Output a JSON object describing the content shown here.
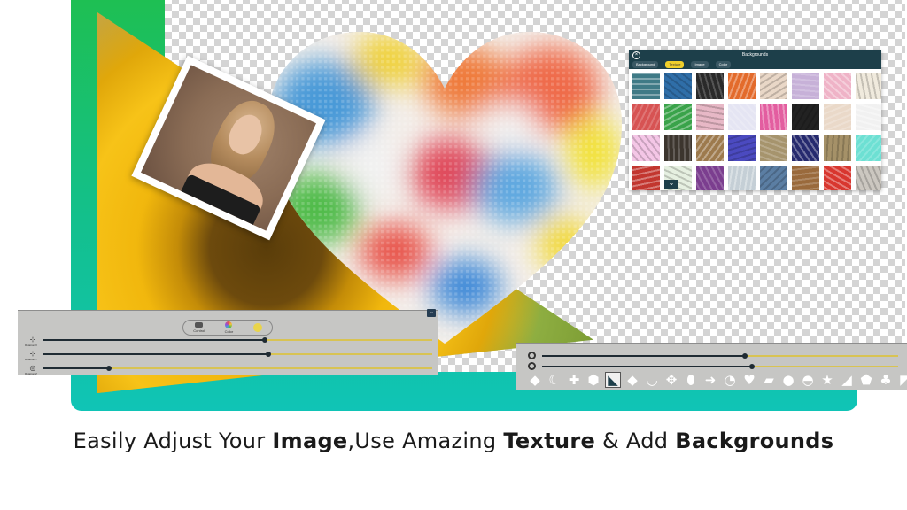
{
  "backgrounds_panel": {
    "title": "Backgrounds",
    "close_icon": "close-icon",
    "tabs": [
      {
        "label": "Background"
      },
      {
        "label": "Texture",
        "active": true
      },
      {
        "label": "Image"
      },
      {
        "label": "Color"
      }
    ],
    "expand_icon": "chevron-down-icon",
    "tile_colors": [
      "#3f7a86",
      "#2f6ea8",
      "#2a2a2a",
      "#e36b2c",
      "#e9d7c7",
      "#c7b1d8",
      "#efb3c7",
      "#f0eadd",
      "#d75353",
      "#3aa34a",
      "#e7b8c6",
      "#e5e5f3",
      "#e35ea0",
      "#222222",
      "#ead9c9",
      "#f1f1f1",
      "#f4c6e6",
      "#3c352e",
      "#9d7a4d",
      "#4b4ac0",
      "#a6946d",
      "#262a6e",
      "#a59168",
      "#6de0d3",
      "#c2362f",
      "#e6f0e1",
      "#7b3e8f",
      "#c5cfd6",
      "#5b7ea3",
      "#9a6a3c",
      "#d8372f",
      "#cbc7c0"
    ]
  },
  "adjust_panel": {
    "collapse_icon": "chevron-down-icon",
    "segments": [
      {
        "label": "Control",
        "icon": "sliders-icon",
        "color": "#555555"
      },
      {
        "label": "Color",
        "icon": "color-wheel-icon",
        "color": "#e8534a"
      },
      {
        "label": "",
        "icon": "sun-icon",
        "color": "#e9d44a"
      }
    ],
    "sliders": [
      {
        "icon": "rotate-x-icon",
        "glyph": "⊹",
        "label": "Rotation X",
        "value": 0.57
      },
      {
        "icon": "rotate-y-icon",
        "glyph": "⊹",
        "label": "Rotation Y",
        "value": 0.58
      },
      {
        "icon": "rotate-z-icon",
        "glyph": "◎",
        "label": "Rotation Z",
        "value": 0.17
      }
    ]
  },
  "shape_panel": {
    "sliders": [
      {
        "icon": "size-icon",
        "value": 0.57
      },
      {
        "icon": "opacity-icon",
        "value": 0.59
      }
    ],
    "shapes": [
      {
        "icon": "diamond-shape-icon",
        "glyph": "◆"
      },
      {
        "icon": "crescent-shape-icon",
        "glyph": "☾"
      },
      {
        "icon": "cross-shape-icon",
        "glyph": "✚"
      },
      {
        "icon": "hexagon-shape-icon",
        "glyph": "⬢"
      },
      {
        "icon": "triangle-shape-icon",
        "glyph": "◣",
        "selected": true
      },
      {
        "icon": "rhombus-shape-icon",
        "glyph": "◆"
      },
      {
        "icon": "arc-shape-icon",
        "glyph": "◡"
      },
      {
        "icon": "quatrefoil-shape-icon",
        "glyph": "✥"
      },
      {
        "icon": "oval-shape-icon",
        "glyph": "⬮"
      },
      {
        "icon": "arrow-shape-icon",
        "glyph": "➜"
      },
      {
        "icon": "pie-shape-icon",
        "glyph": "◔"
      },
      {
        "icon": "heart-shape-icon",
        "glyph": "♥"
      },
      {
        "icon": "parallelogram-shape-icon",
        "glyph": "▰"
      },
      {
        "icon": "circle-shape-icon",
        "glyph": "●"
      },
      {
        "icon": "semicircle-shape-icon",
        "glyph": "◓"
      },
      {
        "icon": "star-shape-icon",
        "glyph": "★"
      },
      {
        "icon": "right-triangle-shape-icon",
        "glyph": "◢"
      },
      {
        "icon": "pentagon-shape-icon",
        "glyph": "⬟"
      },
      {
        "icon": "club-shape-icon",
        "glyph": "♣"
      },
      {
        "icon": "slash-shape-icon",
        "glyph": "◤"
      }
    ]
  },
  "caption": {
    "part1": "Easily Adjust Your ",
    "bold1": "Image",
    "part2": ",Use Amazing ",
    "bold2": "Texture",
    "part3": " & Add ",
    "bold3": "Backgrounds"
  },
  "colors": {
    "frame_top": "#1fbf4e",
    "frame_bottom": "#10c4b6",
    "panel_dark": "#1d3f4a",
    "slider_track": "#d8c353"
  }
}
